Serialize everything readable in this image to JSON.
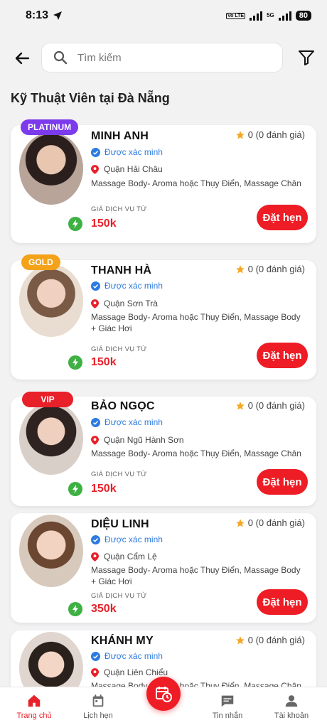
{
  "status_bar": {
    "time": "8:13",
    "network_tag": "Vo LTE",
    "network_5g": "5G",
    "battery": "80"
  },
  "search": {
    "placeholder": "Tìm kiếm"
  },
  "section_title": "Kỹ Thuật Viên tại Đà Nẵng",
  "labels": {
    "verified": "Được xác minh",
    "price_label": "GIÁ DỊCH VỤ TỪ",
    "book": "Đặt hẹn"
  },
  "therapists": [
    {
      "badge": "PLATINUM",
      "badge_color": "#7c3aed",
      "name": "MINH ANH",
      "rating": "0 (0 đánh giá)",
      "district": "Quận Hải Châu",
      "services": "Massage Body- Aroma hoặc Thụy Điển, Massage Chân",
      "price": "150k"
    },
    {
      "badge": "GOLD",
      "badge_color": "#f4a21a",
      "name": "THANH HÀ",
      "rating": "0 (0 đánh giá)",
      "district": "Quận Sơn Trà",
      "services": "Massage Body- Aroma hoặc Thụy Điển, Massage Body + Giác Hơi",
      "price": "150k"
    },
    {
      "badge": "VIP",
      "badge_color": "#e8202a",
      "name": "BẢO NGỌC",
      "rating": "0 (0 đánh giá)",
      "district": "Quận Ngũ Hành Sơn",
      "services": "Massage Body- Aroma hoặc Thụy Điển, Massage Chân",
      "price": "150k"
    },
    {
      "badge": "",
      "badge_color": "",
      "name": "DIỆU LINH",
      "rating": "0 (0 đánh giá)",
      "district": "Quận Cẩm Lệ",
      "services": "Massage Body- Aroma hoặc Thụy Điển, Massage Body + Giác Hơi",
      "price": "350k"
    },
    {
      "badge": "",
      "badge_color": "",
      "name": "KHÁNH MY",
      "rating": "0 (0 đánh giá)",
      "district": "Quận Liên Chiểu",
      "services": "Massage Body- Aroma hoặc Thụy Điển, Massage Chân",
      "price": ""
    }
  ],
  "nav": {
    "home": "Trang chủ",
    "appointments": "Lịch hẹn",
    "messages": "Tin nhắn",
    "account": "Tài khoản"
  },
  "colors": {
    "accent": "#ee1c25",
    "verified": "#2d7be0",
    "bolt": "#3fb043",
    "star": "#f5a623"
  }
}
